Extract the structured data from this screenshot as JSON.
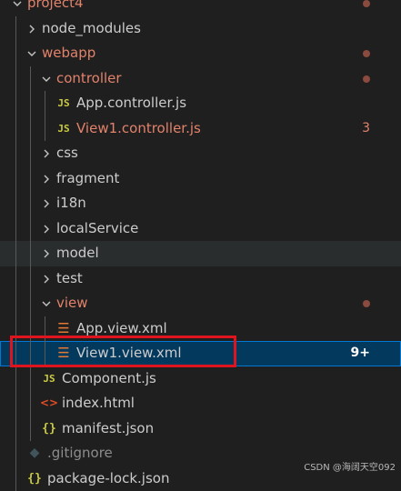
{
  "explorer": {
    "items": [
      {
        "label": "project4",
        "type": "folder",
        "expanded": true,
        "modified": true,
        "depth": 0
      },
      {
        "label": "node_modules",
        "type": "folder",
        "expanded": false,
        "depth": 1
      },
      {
        "label": "webapp",
        "type": "folder",
        "expanded": true,
        "modified": true,
        "depth": 1
      },
      {
        "label": "controller",
        "type": "folder",
        "expanded": true,
        "modified": true,
        "depth": 2
      },
      {
        "label": "App.controller.js",
        "type": "js",
        "icon_text": "JS",
        "depth": 3
      },
      {
        "label": "View1.controller.js",
        "type": "js",
        "icon_text": "JS",
        "modified": true,
        "badge": "3",
        "depth": 3
      },
      {
        "label": "css",
        "type": "folder",
        "expanded": false,
        "depth": 2
      },
      {
        "label": "fragment",
        "type": "folder",
        "expanded": false,
        "depth": 2
      },
      {
        "label": "i18n",
        "type": "folder",
        "expanded": false,
        "depth": 2
      },
      {
        "label": "localService",
        "type": "folder",
        "expanded": false,
        "depth": 2
      },
      {
        "label": "model",
        "type": "folder",
        "expanded": false,
        "depth": 2,
        "hover": true
      },
      {
        "label": "test",
        "type": "folder",
        "expanded": false,
        "depth": 2
      },
      {
        "label": "view",
        "type": "folder",
        "expanded": true,
        "modified": true,
        "depth": 2
      },
      {
        "label": "App.view.xml",
        "type": "xml",
        "icon_text": "☰",
        "depth": 3
      },
      {
        "label": "View1.view.xml",
        "type": "xml",
        "icon_text": "☰",
        "selected": true,
        "badge": "9+",
        "depth": 3
      },
      {
        "label": "Component.js",
        "type": "js",
        "icon_text": "JS",
        "depth": 2
      },
      {
        "label": "index.html",
        "type": "html",
        "icon_text": "<>",
        "depth": 2
      },
      {
        "label": "manifest.json",
        "type": "json",
        "icon_text": "{}",
        "depth": 2
      },
      {
        "label": ".gitignore",
        "type": "git",
        "icon_text": "◆",
        "depth": 1,
        "ignored": true
      },
      {
        "label": "package-lock.json",
        "type": "json",
        "icon_text": "{}",
        "depth": 1
      }
    ]
  },
  "watermark": "CSDN @海阔天空092",
  "colors": {
    "background": "#1f1f1f",
    "modified_text": "#e2826b",
    "selected_bg": "#04395e",
    "highlight_box": "#e0141e"
  }
}
